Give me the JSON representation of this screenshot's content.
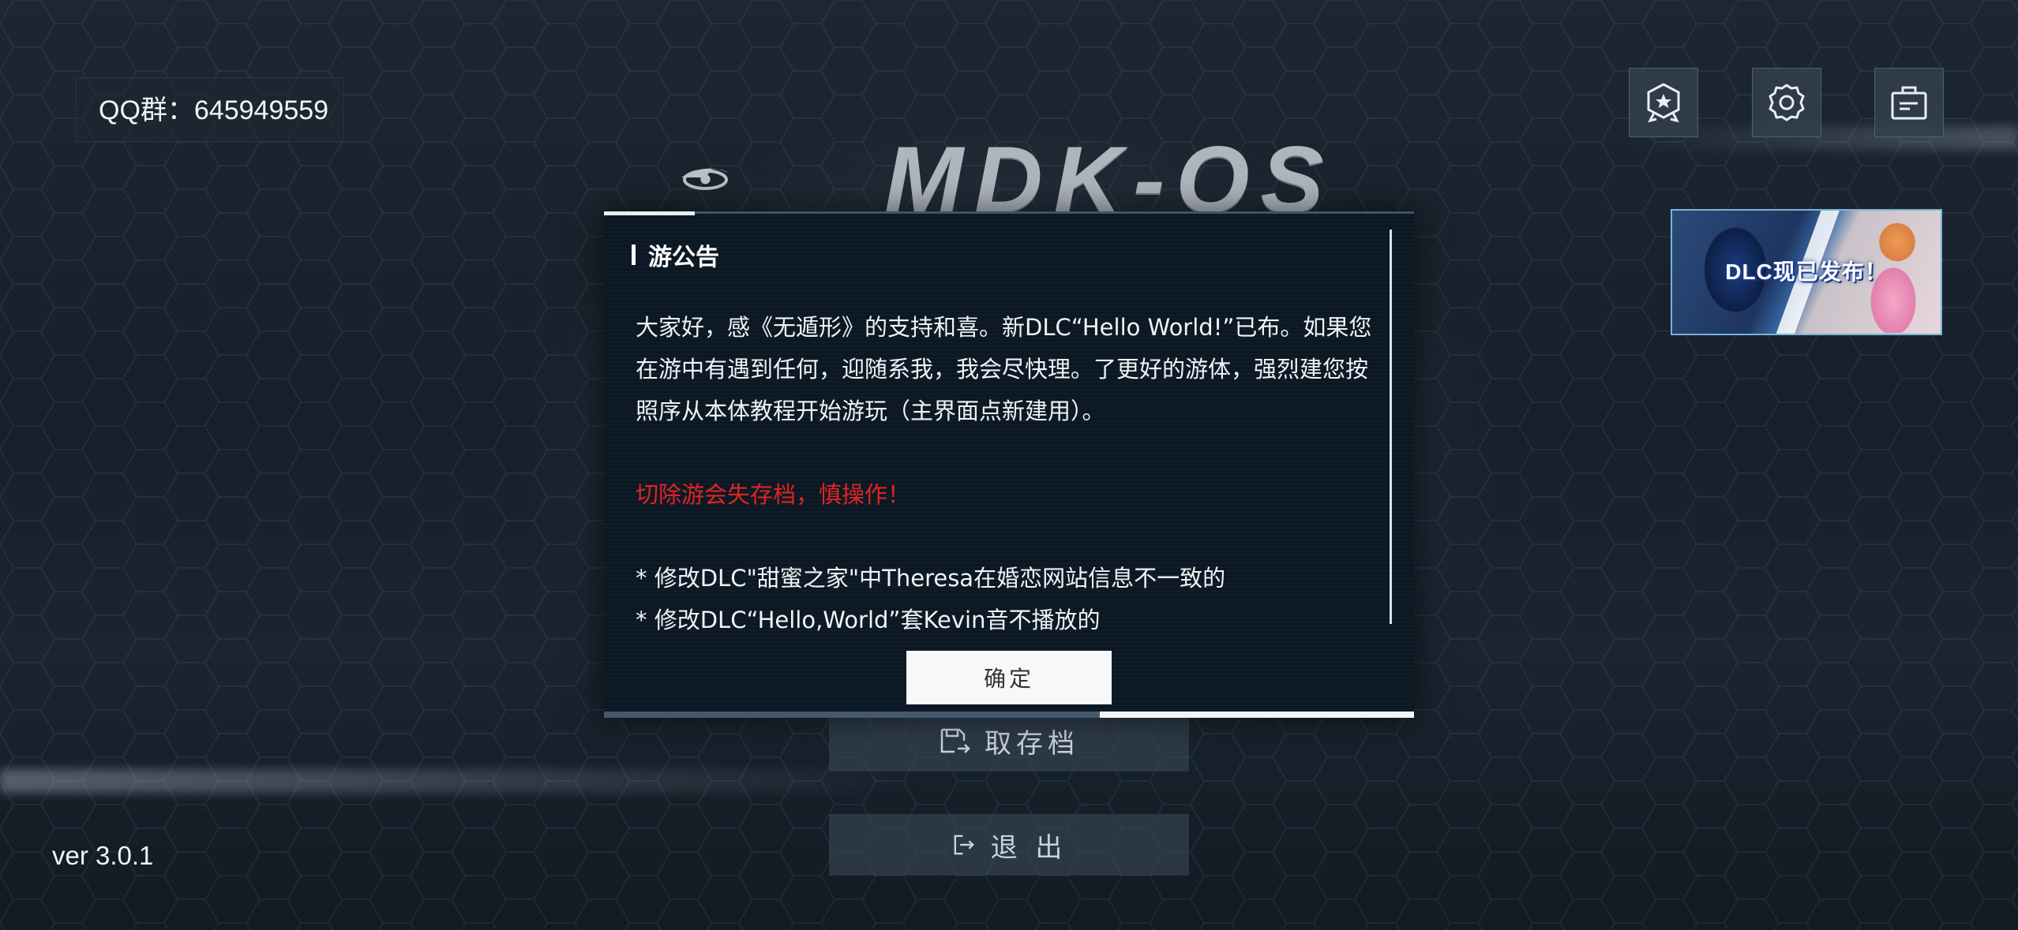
{
  "qq_group": "QQ群：645949559",
  "version": "ver 3.0.1",
  "logo_text": "MDK-OS",
  "top_icons": [
    {
      "name": "achievement-icon"
    },
    {
      "name": "settings-gear-icon"
    },
    {
      "name": "briefcase-icon"
    }
  ],
  "banner": {
    "label": "DLC现已发布！"
  },
  "menu": {
    "load_label": "取存档",
    "exit_label": "退 出"
  },
  "dialog": {
    "title": "游公告",
    "paragraph1": "大家好，感《无遁形》的支持和喜。新DLC“Hello World!”已布。如果您在游中有遇到任何，迎随系我，我会尽快理。了更好的游体，强烈建您按照序从本体教程开始游玩（主界面点新建用）。",
    "warning": "切除游会失存档，慎操作！",
    "changes": [
      "* 修改DLC\"甜蜜之家\"中Theresa在婚恋网站信息不一致的",
      "* 修改DLC“Hello,World”套Kevin音不播放的"
    ],
    "confirm_label": "确定"
  },
  "colors": {
    "warning": "#e02424",
    "dialog_bg": "#0b1823",
    "accent": "#7ab3d6"
  }
}
